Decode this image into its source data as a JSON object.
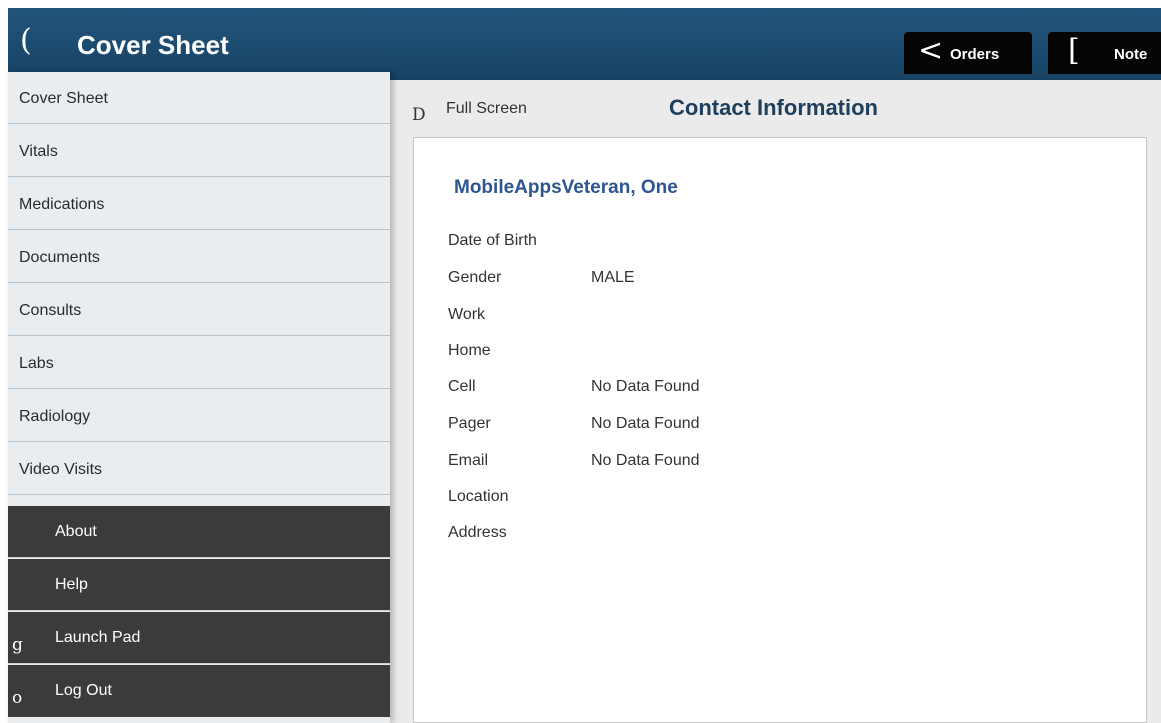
{
  "header": {
    "back_glyph": "(",
    "title": "Cover Sheet",
    "buttons": {
      "orders": {
        "glyph": "<",
        "label": "Orders"
      },
      "note": {
        "glyph": "[",
        "label": "Note"
      }
    }
  },
  "sidebar": {
    "nav_items": [
      {
        "label": "Cover Sheet"
      },
      {
        "label": "Vitals"
      },
      {
        "label": "Medications"
      },
      {
        "label": "Documents"
      },
      {
        "label": "Consults"
      },
      {
        "label": "Labs"
      },
      {
        "label": "Radiology"
      },
      {
        "label": "Video Visits"
      }
    ],
    "util_items": [
      {
        "label": "About",
        "glyph": ""
      },
      {
        "label": "Help",
        "glyph": ""
      },
      {
        "label": "Launch Pad",
        "glyph": "g"
      },
      {
        "label": "Log Out",
        "glyph": "o"
      }
    ]
  },
  "main": {
    "fullscreen_glyph": "D",
    "fullscreen_label": "Full Screen",
    "section_title": "Contact Information",
    "patient_name": "MobileAppsVeteran, One",
    "fields": [
      {
        "label": "Date of Birth",
        "value": ""
      },
      {
        "label": "Gender",
        "value": "MALE"
      },
      {
        "label": "Work",
        "value": ""
      },
      {
        "label": "Home",
        "value": ""
      },
      {
        "label": "Cell",
        "value": "No Data Found"
      },
      {
        "label": "Pager",
        "value": "No Data Found"
      },
      {
        "label": "Email",
        "value": "No Data Found"
      },
      {
        "label": "Location",
        "value": ""
      },
      {
        "label": "Address",
        "value": ""
      }
    ]
  },
  "colors": {
    "header_bg": "#1c4a6e",
    "title_blue": "#1f3f5e",
    "name_blue": "#2e568f",
    "util_bg": "#3b3b3b"
  }
}
